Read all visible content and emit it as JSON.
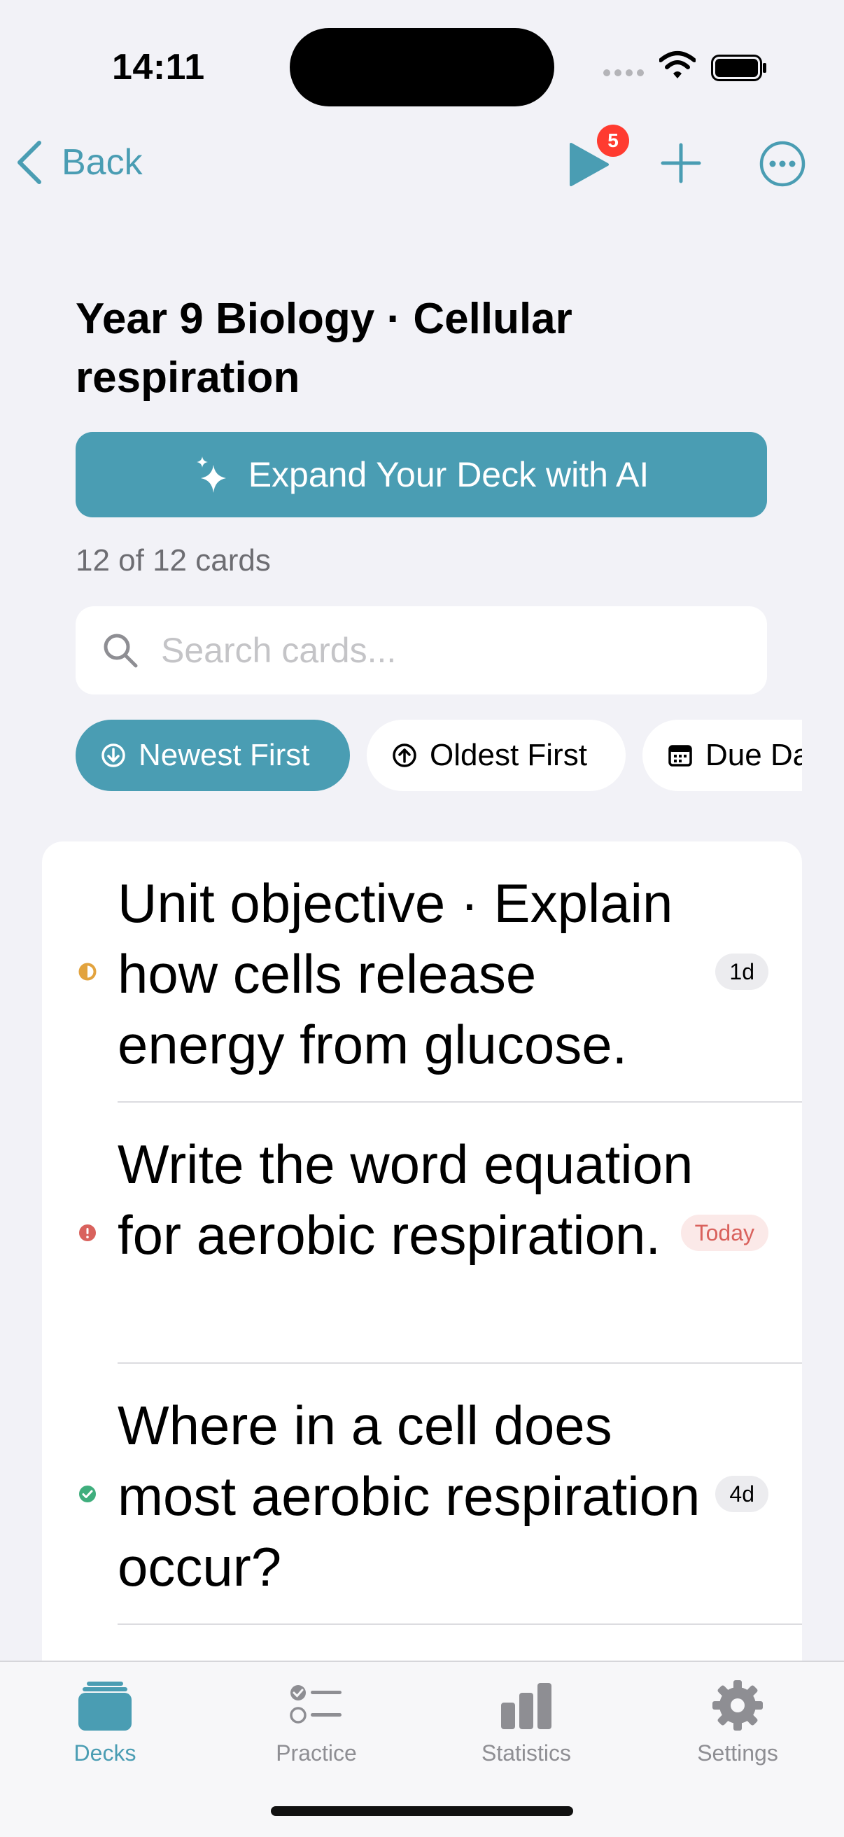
{
  "status_bar": {
    "time": "14:11"
  },
  "nav": {
    "back_label": "Back",
    "play_badge": "5"
  },
  "deck": {
    "title": "Year 9 Biology · Cellular respiration"
  },
  "ai_button": {
    "label": "Expand Your Deck with AI"
  },
  "card_count": "12 of 12 cards",
  "search": {
    "placeholder": "Search cards..."
  },
  "sort_options": [
    {
      "label": "Newest First",
      "active": true
    },
    {
      "label": "Oldest First",
      "active": false
    },
    {
      "label": "Due Date",
      "active": false
    }
  ],
  "cards": [
    {
      "text": "Unit objective · Explain how cells release energy from glucose.",
      "due": "1d",
      "status": "learning",
      "status_color": "#e2a33e"
    },
    {
      "text": "Write the word equation for aerobic respiration.",
      "due": "Today",
      "status": "overdue",
      "status_color": "#d9625d"
    },
    {
      "text": "Where in a cell does most aerobic respiration occur?",
      "due": "4d",
      "status": "mastered",
      "status_color": "#3fae7d"
    }
  ],
  "tabs": [
    {
      "label": "Decks",
      "icon": "decks-icon",
      "active": true
    },
    {
      "label": "Practice",
      "icon": "practice-icon",
      "active": false
    },
    {
      "label": "Statistics",
      "icon": "statistics-icon",
      "active": false
    },
    {
      "label": "Settings",
      "icon": "settings-icon",
      "active": false
    }
  ],
  "colors": {
    "accent": "#4a9db3",
    "background": "#f2f2f7",
    "badge_red": "#ff3b30"
  }
}
